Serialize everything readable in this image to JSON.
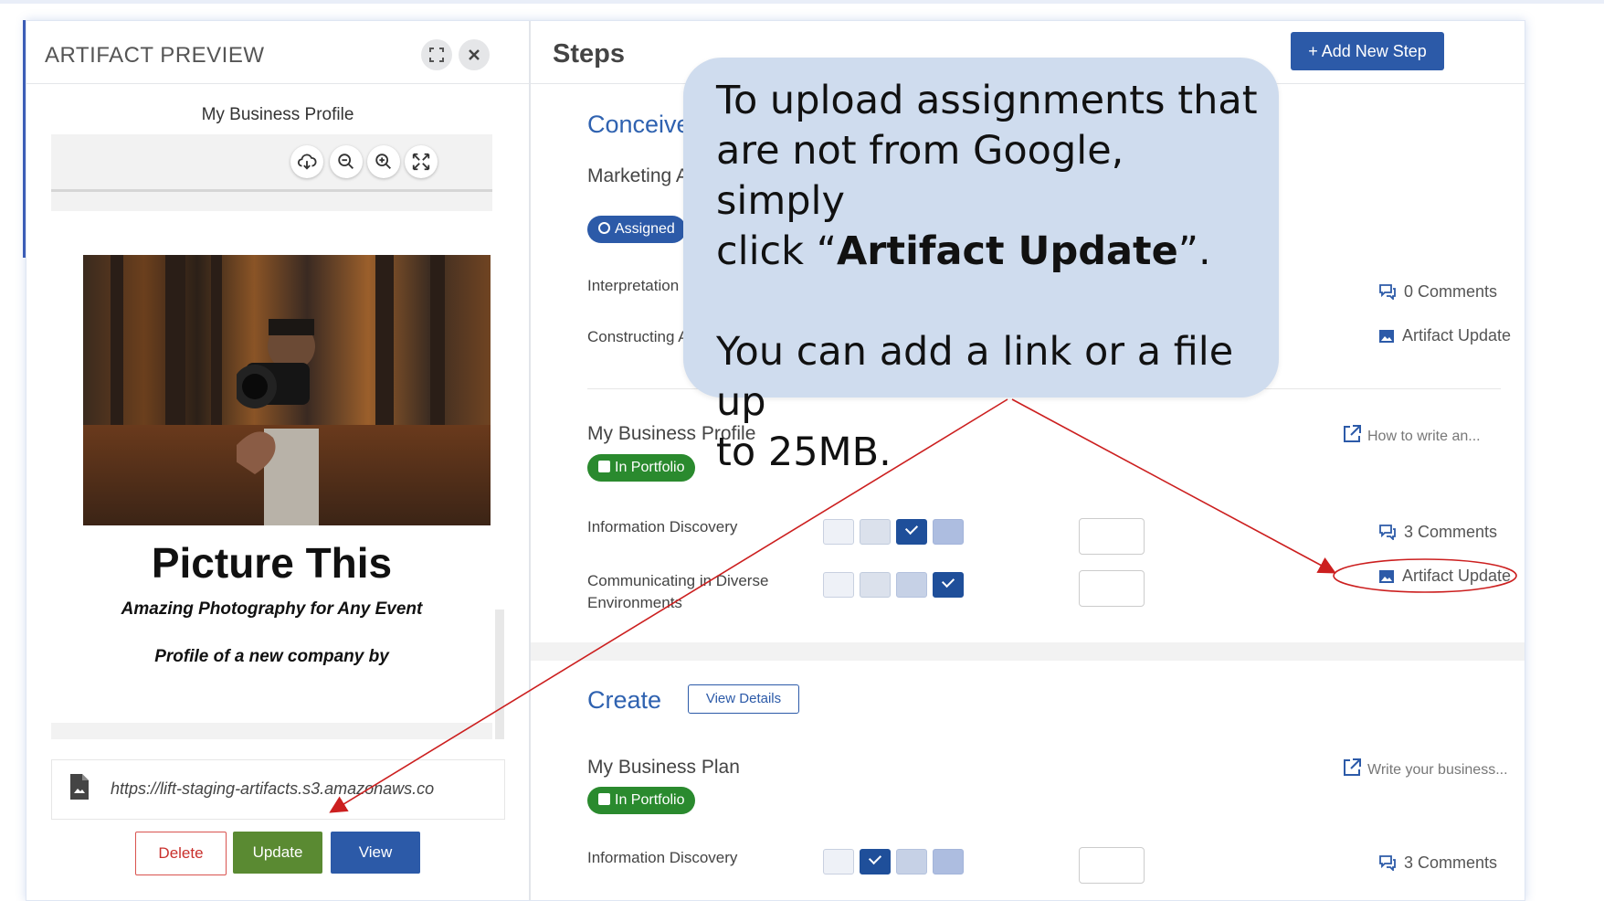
{
  "left_panel": {
    "title": "ARTIFACT PREVIEW",
    "document_name": "My Business Profile",
    "preview": {
      "title": "Picture This",
      "subtitle": "Amazing Photography for Any Event",
      "byline": "Profile of a new company by"
    },
    "url": "https://lift-staging-artifacts.s3.amazonaws.co",
    "buttons": {
      "delete": "Delete",
      "update": "Update",
      "view": "View"
    }
  },
  "right_panel": {
    "title": "Steps",
    "add_step_label": "+ Add New Step",
    "conceive": {
      "title": "Conceive",
      "item_title": "Marketing Ab",
      "badge": "Assigned",
      "sub1": "Interpretation & /",
      "sub2": "Constructing Arg",
      "comments": "0 Comments",
      "artifact_update": "Artifact Update"
    },
    "business_profile": {
      "title": "My Business Profile",
      "badge": "In Portfolio",
      "link": "How to write an...",
      "sub1": "Information Discovery",
      "sub2_line1": "Communicating in Diverse",
      "sub2_line2": "Environments",
      "comments": "3 Comments",
      "artifact_update": "Artifact Update"
    },
    "create": {
      "title": "Create",
      "details_label": "View Details",
      "item_title": "My Business Plan",
      "badge": "In Portfolio",
      "link": "Write your business...",
      "sub1": "Information Discovery",
      "comments": "3 Comments"
    }
  },
  "callout": {
    "line1": "To upload assignments that",
    "line2": "are not from Google, simply",
    "line3_pre": "click “",
    "line3_bold": "Artifact Update",
    "line3_post": "”.",
    "line4": "You can add a link or a file up",
    "line5": "to 25MB."
  },
  "colors": {
    "accent": "#2c5aa8",
    "green": "#2a8a2e",
    "update_green": "#5a8a32",
    "callout_bg": "#cfdcee",
    "arrow": "#cc1f1f"
  },
  "icons": [
    "expand-icon",
    "close-icon",
    "cloud-download-icon",
    "zoom-out-icon",
    "zoom-in-icon",
    "fullscreen-icon",
    "file-icon",
    "comment-icon",
    "image-icon",
    "external-link-icon",
    "folder-icon"
  ]
}
